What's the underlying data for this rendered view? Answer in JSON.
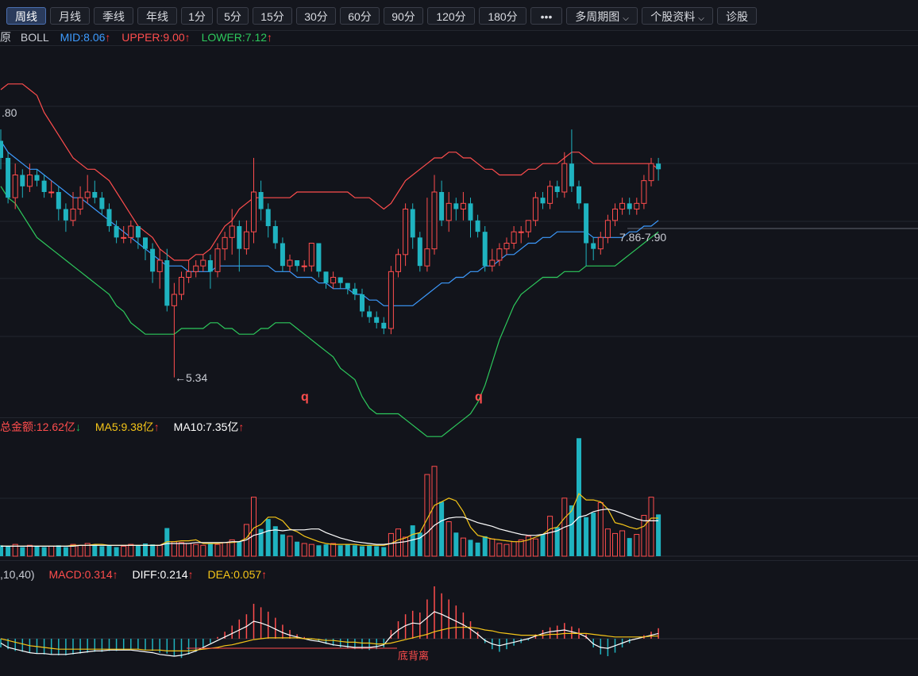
{
  "toolbar": {
    "tabs": [
      "周线",
      "月线",
      "季线",
      "年线",
      "1分",
      "5分",
      "15分",
      "30分",
      "60分",
      "90分",
      "120分",
      "180分",
      "•••",
      "多周期图",
      "个股资料",
      "诊股"
    ]
  },
  "boll": {
    "prefix": "原",
    "name": "BOLL",
    "mid": "MID:8.06",
    "upper": "UPPER:9.00",
    "lower": "LOWER:7.12",
    "colors": {
      "mid": "#3d9bff",
      "upper": "#ff4d4d",
      "lower": "#2dc95c"
    }
  },
  "price_labels": {
    "high_left": ".80",
    "low": "←5.34",
    "range": "7.86-7.90",
    "marker1": "q",
    "marker2": "q"
  },
  "volume": {
    "total": "总金额:12.62亿",
    "ma5": "MA5:9.38亿",
    "ma10": "MA10:7.35亿"
  },
  "macd": {
    "params": ",10,40)",
    "macd": "MACD:0.314",
    "diff": "DIFF:0.214",
    "dea": "DEA:0.057",
    "annotation": "底背离"
  },
  "chart_data": {
    "type": "candlestick",
    "up_color": "#ff4d4d",
    "down_color": "#1fb3c0",
    "price": {
      "ylim": [
        5.0,
        11.0
      ]
    },
    "candles": [
      [
        9.5,
        9.2,
        9.7,
        9.0
      ],
      [
        9.2,
        8.5,
        9.3,
        8.4
      ],
      [
        8.5,
        8.9,
        9.1,
        8.3
      ],
      [
        8.9,
        8.7,
        9.0,
        8.5
      ],
      [
        8.7,
        8.9,
        9.1,
        8.6
      ],
      [
        8.9,
        8.8,
        9.0,
        8.7
      ],
      [
        8.8,
        8.6,
        8.9,
        8.5
      ],
      [
        8.6,
        8.6,
        8.8,
        8.5
      ],
      [
        8.6,
        8.3,
        8.7,
        8.1
      ],
      [
        8.3,
        8.1,
        8.4,
        7.9
      ],
      [
        8.1,
        8.3,
        8.6,
        8.0
      ],
      [
        8.3,
        8.5,
        8.7,
        8.2
      ],
      [
        8.5,
        8.6,
        8.9,
        8.4
      ],
      [
        8.6,
        8.5,
        8.8,
        8.4
      ],
      [
        8.5,
        8.3,
        8.6,
        8.2
      ],
      [
        8.3,
        8.0,
        8.4,
        7.9
      ],
      [
        8.0,
        7.8,
        8.1,
        7.7
      ],
      [
        7.8,
        7.8,
        8.0,
        7.7
      ],
      [
        7.8,
        8.0,
        8.1,
        7.7
      ],
      [
        8.0,
        7.8,
        8.0,
        7.6
      ],
      [
        7.8,
        7.6,
        7.8,
        7.4
      ],
      [
        7.6,
        7.2,
        7.7,
        7.0
      ],
      [
        7.2,
        7.4,
        7.6,
        6.9
      ],
      [
        7.4,
        6.6,
        7.6,
        6.5
      ],
      [
        6.6,
        6.8,
        7.0,
        5.34
      ],
      [
        6.8,
        7.1,
        7.2,
        6.7
      ],
      [
        7.1,
        7.2,
        7.4,
        7.0
      ],
      [
        7.2,
        7.3,
        7.4,
        7.1
      ],
      [
        7.3,
        7.4,
        7.5,
        7.2
      ],
      [
        7.4,
        7.2,
        7.5,
        6.9
      ],
      [
        7.2,
        7.6,
        7.7,
        7.1
      ],
      [
        7.6,
        7.8,
        7.9,
        7.4
      ],
      [
        7.8,
        8.0,
        8.3,
        7.5
      ],
      [
        8.0,
        7.6,
        8.1,
        7.2
      ],
      [
        7.6,
        7.9,
        8.1,
        7.5
      ],
      [
        7.9,
        8.6,
        9.2,
        7.7
      ],
      [
        8.6,
        8.3,
        8.8,
        8.1
      ],
      [
        8.3,
        8.0,
        8.4,
        7.8
      ],
      [
        8.0,
        7.7,
        8.1,
        7.6
      ],
      [
        7.7,
        7.3,
        7.8,
        7.2
      ],
      [
        7.3,
        7.4,
        7.5,
        7.2
      ],
      [
        7.4,
        7.3,
        7.4,
        7.2
      ],
      [
        7.3,
        7.3,
        7.4,
        7.2
      ],
      [
        7.3,
        7.7,
        7.7,
        7.2
      ],
      [
        7.7,
        7.2,
        7.7,
        7.1
      ],
      [
        7.2,
        7.0,
        7.2,
        6.9
      ],
      [
        7.0,
        7.1,
        7.2,
        6.9
      ],
      [
        7.1,
        7.0,
        7.1,
        6.9
      ],
      [
        7.0,
        6.9,
        7.0,
        6.8
      ],
      [
        6.9,
        6.8,
        7.0,
        6.7
      ],
      [
        6.8,
        6.5,
        6.9,
        6.4
      ],
      [
        6.5,
        6.4,
        6.6,
        6.3
      ],
      [
        6.4,
        6.3,
        6.5,
        6.2
      ],
      [
        6.3,
        6.2,
        6.4,
        6.1
      ],
      [
        6.2,
        7.2,
        7.3,
        6.1
      ],
      [
        7.2,
        7.5,
        7.6,
        7.1
      ],
      [
        7.5,
        8.3,
        8.4,
        7.3
      ],
      [
        8.3,
        7.8,
        8.4,
        7.6
      ],
      [
        7.8,
        7.3,
        7.9,
        7.2
      ],
      [
        7.3,
        7.6,
        8.5,
        7.2
      ],
      [
        7.6,
        8.6,
        8.9,
        7.5
      ],
      [
        8.6,
        8.1,
        8.8,
        8.0
      ],
      [
        8.1,
        8.4,
        8.6,
        7.9
      ],
      [
        8.4,
        8.3,
        8.5,
        8.1
      ],
      [
        8.3,
        8.4,
        8.6,
        8.1
      ],
      [
        8.4,
        8.1,
        8.5,
        7.8
      ],
      [
        8.1,
        7.9,
        8.2,
        7.8
      ],
      [
        7.9,
        7.3,
        8.0,
        7.2
      ],
      [
        7.3,
        7.4,
        7.6,
        7.2
      ],
      [
        7.4,
        7.6,
        7.7,
        7.3
      ],
      [
        7.6,
        7.7,
        7.8,
        7.5
      ],
      [
        7.7,
        7.9,
        8.0,
        7.6
      ],
      [
        7.9,
        7.9,
        8.0,
        7.7
      ],
      [
        7.9,
        8.1,
        8.1,
        7.8
      ],
      [
        8.1,
        8.5,
        8.6,
        8.0
      ],
      [
        8.5,
        8.4,
        8.6,
        8.3
      ],
      [
        8.4,
        8.7,
        8.8,
        8.3
      ],
      [
        8.7,
        8.6,
        8.8,
        8.5
      ],
      [
        8.6,
        9.1,
        9.3,
        8.5
      ],
      [
        9.1,
        8.7,
        9.7,
        8.6
      ],
      [
        8.7,
        8.4,
        8.8,
        8.3
      ],
      [
        8.4,
        7.7,
        8.0,
        7.3
      ],
      [
        7.7,
        7.6,
        7.8,
        7.4
      ],
      [
        7.6,
        7.8,
        7.9,
        7.5
      ],
      [
        7.8,
        8.1,
        8.2,
        7.7
      ],
      [
        8.1,
        8.3,
        8.4,
        8.0
      ],
      [
        8.3,
        8.4,
        8.5,
        8.2
      ],
      [
        8.4,
        8.3,
        8.5,
        8.2
      ],
      [
        8.3,
        8.4,
        8.5,
        8.2
      ],
      [
        8.4,
        8.8,
        8.9,
        8.3
      ],
      [
        8.8,
        9.1,
        9.2,
        8.7
      ],
      [
        9.1,
        9.0,
        9.2,
        8.8
      ]
    ],
    "upper": [
      10.4,
      10.5,
      10.5,
      10.5,
      10.4,
      10.3,
      10.0,
      9.8,
      9.6,
      9.4,
      9.2,
      9.1,
      9.0,
      9.0,
      8.9,
      8.8,
      8.6,
      8.4,
      8.2,
      8.0,
      7.9,
      7.8,
      7.6,
      7.5,
      7.4,
      7.4,
      7.4,
      7.5,
      7.5,
      7.6,
      7.8,
      8.0,
      8.1,
      8.3,
      8.4,
      8.5,
      8.5,
      8.5,
      8.5,
      8.5,
      8.5,
      8.6,
      8.6,
      8.6,
      8.6,
      8.6,
      8.6,
      8.6,
      8.6,
      8.5,
      8.5,
      8.5,
      8.4,
      8.3,
      8.4,
      8.6,
      8.8,
      8.9,
      9.0,
      9.1,
      9.2,
      9.2,
      9.3,
      9.3,
      9.2,
      9.2,
      9.1,
      9.0,
      9.0,
      8.9,
      8.9,
      8.9,
      8.9,
      9.0,
      9.0,
      9.1,
      9.1,
      9.1,
      9.2,
      9.3,
      9.3,
      9.2,
      9.1,
      9.1,
      9.1,
      9.1,
      9.1,
      9.1,
      9.1,
      9.1,
      9.1,
      9.0
    ],
    "mid": [
      9.5,
      9.3,
      9.2,
      9.1,
      9.0,
      9.0,
      8.9,
      8.8,
      8.7,
      8.6,
      8.5,
      8.5,
      8.4,
      8.3,
      8.2,
      8.1,
      8.0,
      7.9,
      7.8,
      7.7,
      7.6,
      7.5,
      7.4,
      7.3,
      7.3,
      7.3,
      7.2,
      7.2,
      7.2,
      7.2,
      7.3,
      7.3,
      7.3,
      7.3,
      7.3,
      7.3,
      7.3,
      7.3,
      7.2,
      7.2,
      7.2,
      7.1,
      7.1,
      7.1,
      7.0,
      7.0,
      6.9,
      6.9,
      6.9,
      6.8,
      6.8,
      6.7,
      6.7,
      6.6,
      6.6,
      6.6,
      6.6,
      6.6,
      6.7,
      6.8,
      6.9,
      7.0,
      7.0,
      7.1,
      7.1,
      7.2,
      7.2,
      7.3,
      7.3,
      7.4,
      7.5,
      7.5,
      7.6,
      7.7,
      7.7,
      7.8,
      7.8,
      7.9,
      7.9,
      7.9,
      7.9,
      7.9,
      7.8,
      7.8,
      7.8,
      7.8,
      7.8,
      7.9,
      7.9,
      8.0,
      8.0,
      8.1
    ],
    "lower": [
      8.7,
      8.5,
      8.4,
      8.2,
      8.0,
      7.8,
      7.7,
      7.6,
      7.5,
      7.4,
      7.3,
      7.2,
      7.1,
      7.0,
      6.9,
      6.8,
      6.6,
      6.5,
      6.3,
      6.2,
      6.1,
      6.1,
      6.1,
      6.1,
      6.1,
      6.2,
      6.2,
      6.2,
      6.2,
      6.3,
      6.3,
      6.2,
      6.2,
      6.1,
      6.1,
      6.1,
      6.2,
      6.2,
      6.3,
      6.3,
      6.3,
      6.2,
      6.1,
      6.0,
      5.9,
      5.8,
      5.7,
      5.5,
      5.4,
      5.3,
      5.0,
      4.8,
      4.7,
      4.7,
      4.7,
      4.7,
      4.6,
      4.5,
      4.4,
      4.3,
      4.3,
      4.3,
      4.4,
      4.5,
      4.6,
      4.7,
      4.9,
      5.2,
      5.6,
      6.0,
      6.3,
      6.6,
      6.8,
      6.9,
      7.0,
      7.1,
      7.1,
      7.1,
      7.2,
      7.2,
      7.2,
      7.3,
      7.3,
      7.3,
      7.3,
      7.3,
      7.4,
      7.5,
      7.6,
      7.7,
      7.8,
      7.9
    ],
    "volume": [
      1.2,
      1.1,
      1.3,
      1.0,
      1.2,
      1.1,
      1.0,
      1.1,
      1.2,
      1.0,
      1.3,
      1.2,
      1.4,
      1.3,
      1.1,
      1.2,
      1.0,
      1.1,
      1.3,
      1.2,
      1.4,
      1.3,
      1.2,
      3.1,
      1.6,
      1.5,
      1.4,
      1.3,
      1.2,
      1.4,
      1.3,
      1.5,
      1.8,
      1.6,
      3.5,
      6.5,
      3.0,
      4.1,
      3.3,
      2.4,
      2.2,
      1.6,
      1.4,
      1.3,
      1.2,
      1.3,
      1.4,
      1.2,
      1.3,
      1.2,
      1.1,
      1.2,
      1.1,
      1.0,
      2.5,
      3.0,
      2.1,
      3.4,
      2.6,
      9.0,
      9.9,
      6.0,
      3.8,
      2.6,
      2.0,
      1.8,
      1.5,
      2.2,
      1.9,
      1.4,
      1.3,
      1.6,
      1.8,
      2.2,
      1.9,
      2.4,
      4.4,
      3.2,
      6.4,
      5.6,
      13.0,
      4.3,
      4.8,
      5.9,
      3.0,
      2.5,
      2.8,
      2.0,
      2.4,
      4.5,
      6.5,
      4.6
    ],
    "vol_ma5": [
      1.1,
      1.1,
      1.1,
      1.1,
      1.1,
      1.1,
      1.1,
      1.1,
      1.1,
      1.1,
      1.2,
      1.2,
      1.2,
      1.3,
      1.3,
      1.2,
      1.2,
      1.2,
      1.2,
      1.2,
      1.2,
      1.2,
      1.2,
      1.6,
      1.6,
      1.7,
      1.7,
      1.8,
      1.4,
      1.4,
      1.4,
      1.5,
      1.5,
      1.6,
      2.0,
      3.1,
      3.5,
      4.3,
      4.3,
      3.9,
      3.0,
      2.7,
      2.2,
      1.9,
      1.6,
      1.4,
      1.3,
      1.3,
      1.3,
      1.3,
      1.2,
      1.2,
      1.2,
      1.2,
      1.4,
      1.8,
      2.0,
      2.4,
      2.6,
      4.1,
      5.6,
      6.0,
      6.4,
      6.1,
      4.9,
      3.2,
      2.3,
      2.1,
      1.9,
      1.8,
      1.7,
      1.6,
      1.6,
      1.8,
      2.1,
      2.4,
      3.0,
      3.2,
      4.2,
      5.0,
      6.9,
      6.2,
      6.2,
      6.0,
      5.2,
      3.7,
      3.5,
      3.2,
      3.0,
      3.3,
      4.2,
      4.2
    ],
    "vol_ma10": [
      1.1,
      1.1,
      1.1,
      1.1,
      1.1,
      1.1,
      1.1,
      1.1,
      1.1,
      1.1,
      1.1,
      1.2,
      1.2,
      1.2,
      1.2,
      1.2,
      1.2,
      1.2,
      1.2,
      1.2,
      1.2,
      1.2,
      1.2,
      1.4,
      1.4,
      1.4,
      1.4,
      1.5,
      1.5,
      1.5,
      1.5,
      1.5,
      1.6,
      1.6,
      1.8,
      2.3,
      2.5,
      2.8,
      2.9,
      2.8,
      2.9,
      2.9,
      2.9,
      3.0,
      3.0,
      2.6,
      2.3,
      2.0,
      1.8,
      1.6,
      1.5,
      1.4,
      1.3,
      1.3,
      1.4,
      1.5,
      1.6,
      1.8,
      2.0,
      2.6,
      3.4,
      3.9,
      4.2,
      4.3,
      4.3,
      4.0,
      3.7,
      3.5,
      3.3,
      3.0,
      2.8,
      2.6,
      2.4,
      2.3,
      2.3,
      2.4,
      2.6,
      2.8,
      3.2,
      3.5,
      4.3,
      4.5,
      4.9,
      5.1,
      5.2,
      5.0,
      4.7,
      4.4,
      4.1,
      3.9,
      3.9,
      3.9
    ],
    "macd_hist": [
      -0.1,
      -0.12,
      -0.14,
      -0.15,
      -0.16,
      -0.17,
      -0.18,
      -0.18,
      -0.19,
      -0.19,
      -0.18,
      -0.17,
      -0.16,
      -0.15,
      -0.15,
      -0.14,
      -0.14,
      -0.13,
      -0.12,
      -0.12,
      -0.13,
      -0.14,
      -0.16,
      -0.17,
      -0.2,
      -0.22,
      -0.18,
      -0.15,
      -0.1,
      -0.05,
      0.02,
      0.08,
      0.15,
      0.22,
      0.28,
      0.4,
      0.36,
      0.31,
      0.24,
      0.16,
      0.1,
      0.05,
      0.02,
      -0.01,
      -0.03,
      -0.06,
      -0.08,
      -0.1,
      -0.11,
      -0.12,
      -0.12,
      -0.13,
      -0.12,
      -0.1,
      0.1,
      0.2,
      0.28,
      0.32,
      0.3,
      0.45,
      0.6,
      0.52,
      0.45,
      0.38,
      0.3,
      0.2,
      0.08,
      -0.05,
      -0.12,
      -0.15,
      -0.12,
      -0.08,
      -0.05,
      -0.02,
      0.05,
      0.1,
      0.13,
      0.15,
      0.18,
      0.14,
      0.12,
      0.05,
      -0.1,
      -0.18,
      -0.2,
      -0.16,
      -0.1,
      -0.05,
      0.0,
      0.04,
      0.08,
      0.12
    ],
    "macd_diff": [
      -0.05,
      -0.1,
      -0.12,
      -0.14,
      -0.16,
      -0.17,
      -0.17,
      -0.18,
      -0.18,
      -0.18,
      -0.17,
      -0.16,
      -0.15,
      -0.14,
      -0.14,
      -0.13,
      -0.13,
      -0.13,
      -0.13,
      -0.14,
      -0.15,
      -0.16,
      -0.18,
      -0.19,
      -0.2,
      -0.19,
      -0.17,
      -0.14,
      -0.1,
      -0.06,
      -0.02,
      0.02,
      0.06,
      0.1,
      0.14,
      0.2,
      0.18,
      0.15,
      0.11,
      0.07,
      0.04,
      0.02,
      0.0,
      -0.02,
      -0.03,
      -0.05,
      -0.07,
      -0.08,
      -0.09,
      -0.1,
      -0.1,
      -0.1,
      -0.09,
      -0.07,
      0.03,
      0.1,
      0.15,
      0.18,
      0.17,
      0.24,
      0.31,
      0.28,
      0.24,
      0.2,
      0.16,
      0.11,
      0.05,
      -0.02,
      -0.06,
      -0.08,
      -0.06,
      -0.04,
      -0.02,
      0.0,
      0.03,
      0.06,
      0.08,
      0.09,
      0.1,
      0.08,
      0.06,
      0.02,
      -0.06,
      -0.1,
      -0.11,
      -0.08,
      -0.05,
      -0.02,
      0.0,
      0.02,
      0.04,
      0.06
    ],
    "macd_dea": [
      0.0,
      -0.02,
      -0.04,
      -0.06,
      -0.08,
      -0.09,
      -0.1,
      -0.11,
      -0.12,
      -0.12,
      -0.12,
      -0.12,
      -0.12,
      -0.12,
      -0.12,
      -0.12,
      -0.12,
      -0.12,
      -0.12,
      -0.12,
      -0.13,
      -0.13,
      -0.13,
      -0.14,
      -0.14,
      -0.14,
      -0.14,
      -0.13,
      -0.12,
      -0.11,
      -0.1,
      -0.08,
      -0.07,
      -0.05,
      -0.03,
      -0.01,
      0.0,
      0.01,
      0.01,
      0.01,
      0.01,
      0.01,
      0.0,
      0.0,
      -0.01,
      -0.02,
      -0.02,
      -0.03,
      -0.04,
      -0.04,
      -0.05,
      -0.05,
      -0.06,
      -0.06,
      -0.05,
      -0.03,
      -0.01,
      0.01,
      0.03,
      0.05,
      0.08,
      0.1,
      0.12,
      0.13,
      0.13,
      0.13,
      0.12,
      0.1,
      0.09,
      0.07,
      0.06,
      0.05,
      0.04,
      0.04,
      0.04,
      0.04,
      0.05,
      0.05,
      0.06,
      0.06,
      0.06,
      0.06,
      0.05,
      0.04,
      0.03,
      0.02,
      0.02,
      0.02,
      0.02,
      0.02,
      0.03,
      0.03
    ]
  }
}
